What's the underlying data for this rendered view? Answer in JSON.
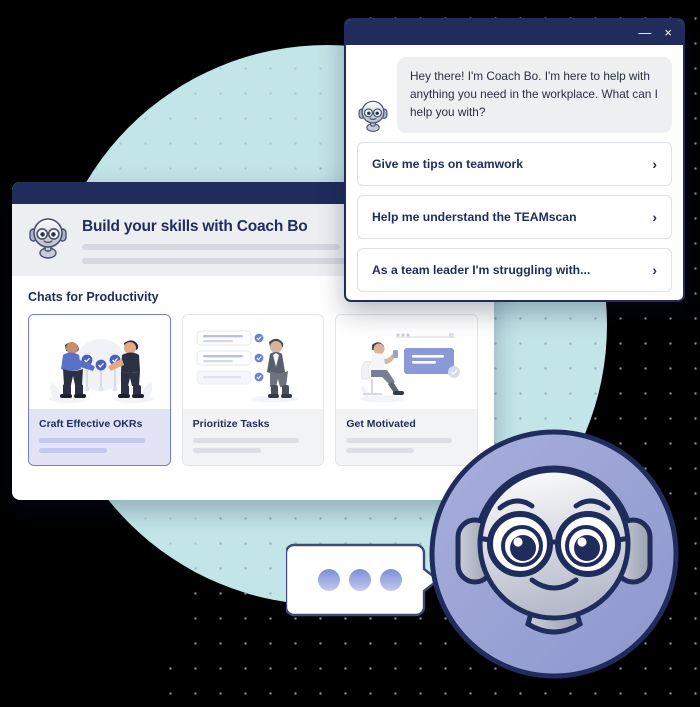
{
  "background": {
    "circle_color": "#c2e5e8",
    "dot_color": "#9aa3b5",
    "page_color": "#000000"
  },
  "app_window": {
    "titlebar_color": "#1f2c5c",
    "header": {
      "avatar_icon": "coach-bo-robot-icon",
      "title": "Build your skills with Coach Bo",
      "skeleton_lines": 2
    },
    "section_title": "Chats for Productivity",
    "cards": [
      {
        "label": "Craft Effective OKRs",
        "illustration": "two-people-handshake-milestones-illustration",
        "selected": true
      },
      {
        "label": "Prioritize Tasks",
        "illustration": "checklist-with-standing-person-illustration",
        "selected": false
      },
      {
        "label": "Get Motivated",
        "illustration": "seated-person-with-message-illustration",
        "selected": false
      }
    ]
  },
  "chat_window": {
    "accent_color": "#1f2c5c",
    "titlebar": {
      "minimize_label": "—",
      "close_label": "×"
    },
    "avatar_icon": "coach-bo-robot-icon",
    "greeting": "Hey there! I'm Coach Bo. I'm here to help with anything you need in the workplace. What can I help you with?",
    "options": [
      {
        "label": "Give me tips on teamwork",
        "chevron": "›"
      },
      {
        "label": "Help me understand the TEAMscan",
        "chevron": "›"
      },
      {
        "label": "As a team leader I'm struggling with...",
        "chevron": "›"
      }
    ]
  },
  "mascot": {
    "icon": "coach-bo-robot-mascot",
    "circle_color": "#9ba4d6",
    "outline_color": "#1f2c5c"
  },
  "speech_bubble": {
    "icon": "typing-dots-speech-bubble",
    "dot_count": 3,
    "dot_color": "#8d9bdb"
  }
}
